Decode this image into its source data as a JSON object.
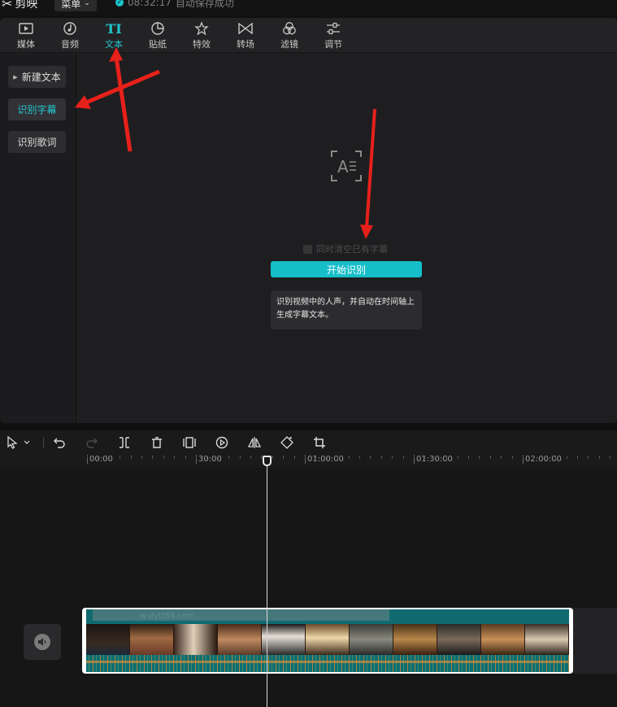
{
  "titlebar": {
    "app_name": "剪映",
    "menu_label": "菜单",
    "save_time": "08:32:17",
    "save_text": "自动保存成功"
  },
  "toolbar": {
    "tabs": [
      {
        "label": "媒体",
        "icon": "media-icon"
      },
      {
        "label": "音频",
        "icon": "audio-icon"
      },
      {
        "label": "文本",
        "icon": "text-icon",
        "active": true
      },
      {
        "label": "贴纸",
        "icon": "sticker-icon"
      },
      {
        "label": "特效",
        "icon": "effects-icon"
      },
      {
        "label": "转场",
        "icon": "transition-icon"
      },
      {
        "label": "滤镜",
        "icon": "filter-icon"
      },
      {
        "label": "调节",
        "icon": "adjust-icon"
      }
    ],
    "active_color": "#22c7d1"
  },
  "sidebar": {
    "items": [
      {
        "label": "新建文本",
        "expandable": true
      },
      {
        "label": "识别字幕",
        "active": true
      },
      {
        "label": "识别歌词"
      }
    ]
  },
  "recognize": {
    "checkbox_label": "同时清空已有字幕",
    "start_button": "开始识别",
    "tip": "识别视频中的人声，并自动在时间轴上生成字幕文本。"
  },
  "timeline": {
    "ruler_labels": [
      "00:00",
      "30:00",
      "01:00:00",
      "01:30:00",
      "02:00:00"
    ],
    "clip_title": "…w.dytt89.com…"
  }
}
